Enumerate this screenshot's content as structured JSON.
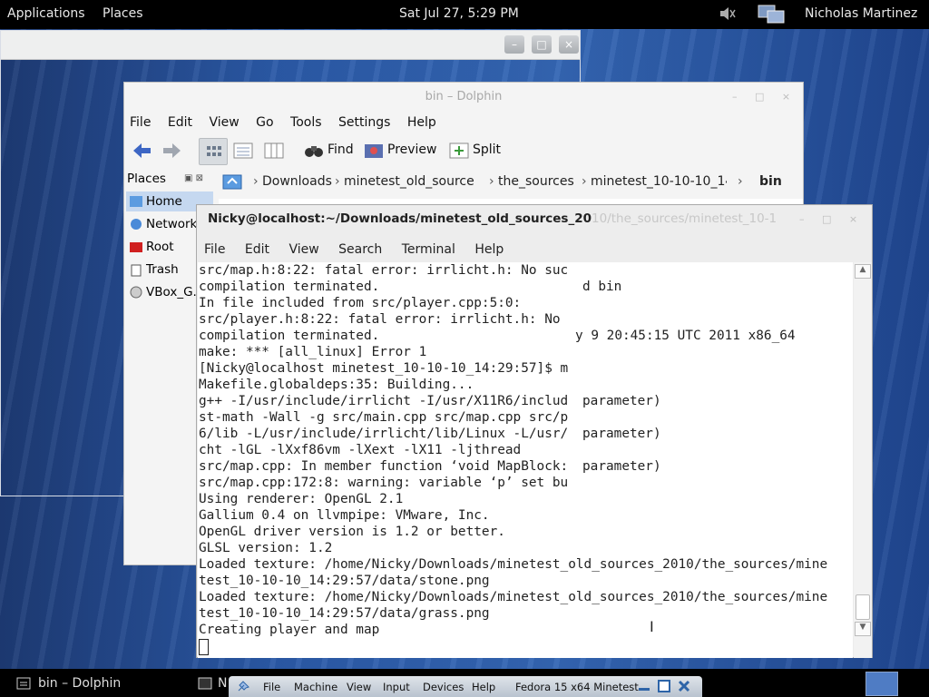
{
  "topbar": {
    "applications": "Applications",
    "places": "Places",
    "clock": "Sat Jul 27,  5:29 PM",
    "user": "Nicholas Martinez"
  },
  "dolphin": {
    "title": "bin – Dolphin",
    "menu": [
      "File",
      "Edit",
      "View",
      "Go",
      "Tools",
      "Settings",
      "Help"
    ],
    "toolbar": {
      "find": "Find",
      "preview": "Preview",
      "split": "Split"
    },
    "places_header": "Places",
    "places": [
      "Home",
      "Network",
      "Root",
      "Trash",
      "VBox_G..."
    ],
    "breadcrumb": [
      "Downloads",
      "minetest_old_source",
      "the_sources",
      "minetest_10-10-10_14",
      "bin"
    ],
    "peek": {
      "bin": "d bin",
      "date": "y 9 20:45:15 UTC 2011 x86_64"
    }
  },
  "terminal": {
    "title_visible": "Nicky@localhost:~/Downloads/minetest_old_sources_20",
    "title_faded": "10/the_sources/minetest_10-1",
    "menu": [
      "File",
      "Edit",
      "View",
      "Search",
      "Terminal",
      "Help"
    ],
    "lines": [
      "src/map.h:8:22: fatal error: irrlicht.h: No suc",
      "compilation terminated.",
      "In file included from src/player.cpp:5:0:",
      "src/player.h:8:22: fatal error: irrlicht.h: No",
      "compilation terminated.",
      "make: *** [all_linux] Error 1",
      "[Nicky@localhost minetest_10-10-10_14:29:57]$ m",
      "Makefile.globaldeps:35: Building...",
      "g++ -I/usr/include/irrlicht -I/usr/X11R6/includ",
      "st-math -Wall -g src/main.cpp src/map.cpp src/p",
      "6/lib -L/usr/include/irrlicht/lib/Linux -L/usr/",
      "cht -lGL -lXxf86vm -lXext -lX11 -ljthread",
      "src/map.cpp: In member function ‘void MapBlock:",
      "src/map.cpp:172:8: warning: variable ‘p’ set bu",
      "Using renderer: OpenGL 2.1",
      "Gallium 0.4 on llvmpipe: VMware, Inc.",
      "OpenGL driver version is 1.2 or better.",
      "GLSL version: 1.2",
      "Loaded texture: /home/Nicky/Downloads/minetest_old_sources_2010/the_sources/mine",
      "test_10-10-10_14:29:57/data/stone.png",
      "Loaded texture: /home/Nicky/Downloads/minetest_old_sources_2010/the_sources/mine",
      "test_10-10-10_14:29:57/data/grass.png",
      "Creating player and map"
    ],
    "param_suffix": "parameter)"
  },
  "taskbar": {
    "dolphin_task": "bin – Dolphin",
    "second_task": "N"
  },
  "vbox_menu": {
    "items": [
      "File",
      "Machine",
      "View",
      "Input",
      "Devices",
      "Help"
    ],
    "vm_name": "Fedora 15 x64 Minetest"
  },
  "colors": {
    "accent": "#2b5aa8",
    "term_bg": "#ffffff",
    "selection": "#c5d8f0"
  }
}
